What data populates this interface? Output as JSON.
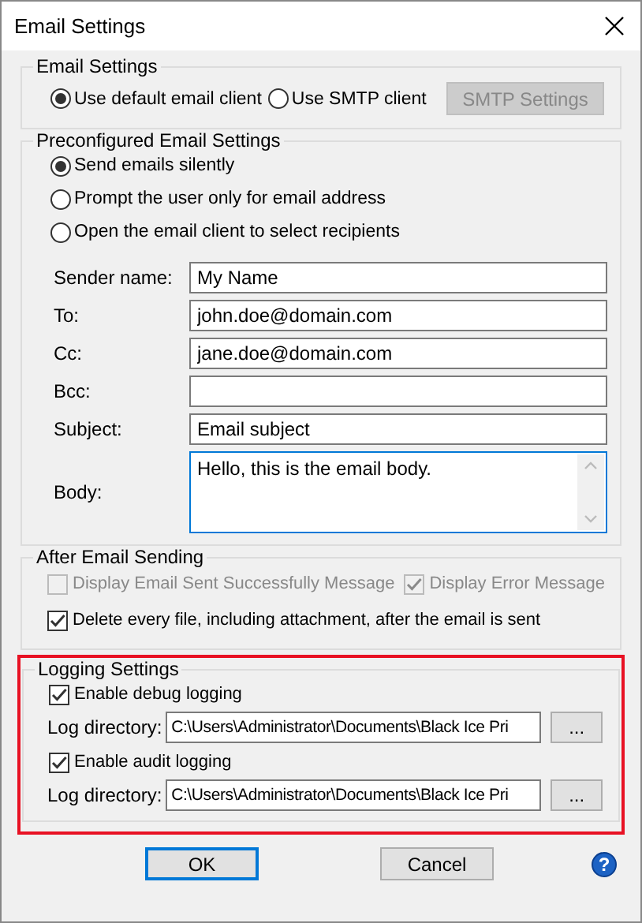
{
  "window": {
    "title": "Email Settings"
  },
  "email_settings": {
    "title": "Email Settings",
    "options": [
      {
        "label": "Use default email client",
        "selected": true
      },
      {
        "label": "Use SMTP client",
        "selected": false
      }
    ],
    "smtp_button": {
      "label": "SMTP Settings",
      "disabled": true
    }
  },
  "preconfigured": {
    "title": "Preconfigured Email Settings",
    "options": [
      {
        "label": "Send emails silently",
        "selected": true
      },
      {
        "label": "Prompt the user only for email address",
        "selected": false
      },
      {
        "label": "Open the email client to select recipients",
        "selected": false
      }
    ],
    "fields": [
      {
        "kind": "line",
        "label": "Sender name:",
        "value": "My Name"
      },
      {
        "kind": "line",
        "label": "To:",
        "value": "john.doe@domain.com"
      },
      {
        "kind": "line",
        "label": "Cc:",
        "value": "jane.doe@domain.com"
      },
      {
        "kind": "line",
        "label": "Bcc:"
      },
      {
        "kind": "line",
        "label": "Subject:",
        "value": "Email subject"
      },
      {
        "kind": "multiline",
        "label": "Body:",
        "value": "Hello, this is the email body.",
        "focused": true
      }
    ]
  },
  "after_sending": {
    "title": "After Email Sending",
    "options": [
      {
        "label": "Display Email Sent Successfully Message",
        "checked": false,
        "disabled": true
      },
      {
        "label": "Display Error Message",
        "checked": true,
        "disabled": true
      },
      {
        "label": "Delete every file, including attachment, after the email is sent",
        "checked": true,
        "disabled": false
      }
    ]
  },
  "logging": {
    "title": "Logging Settings",
    "highlighted": true,
    "entries": [
      {
        "label": "Enable debug logging",
        "checked": true,
        "directory_label": "Log directory:",
        "directory": "C:\\Users\\Administrator\\Documents\\Black Ice Pri",
        "browse_label": "..."
      },
      {
        "label": "Enable audit logging",
        "checked": true,
        "directory_label": "Log directory:",
        "directory": "C:\\Users\\Administrator\\Documents\\Black Ice Pri",
        "browse_label": "..."
      }
    ]
  },
  "buttons": [
    {
      "label": "OK",
      "focused": true
    },
    {
      "label": "Cancel",
      "focused": false
    }
  ],
  "help": {
    "label": "?"
  }
}
